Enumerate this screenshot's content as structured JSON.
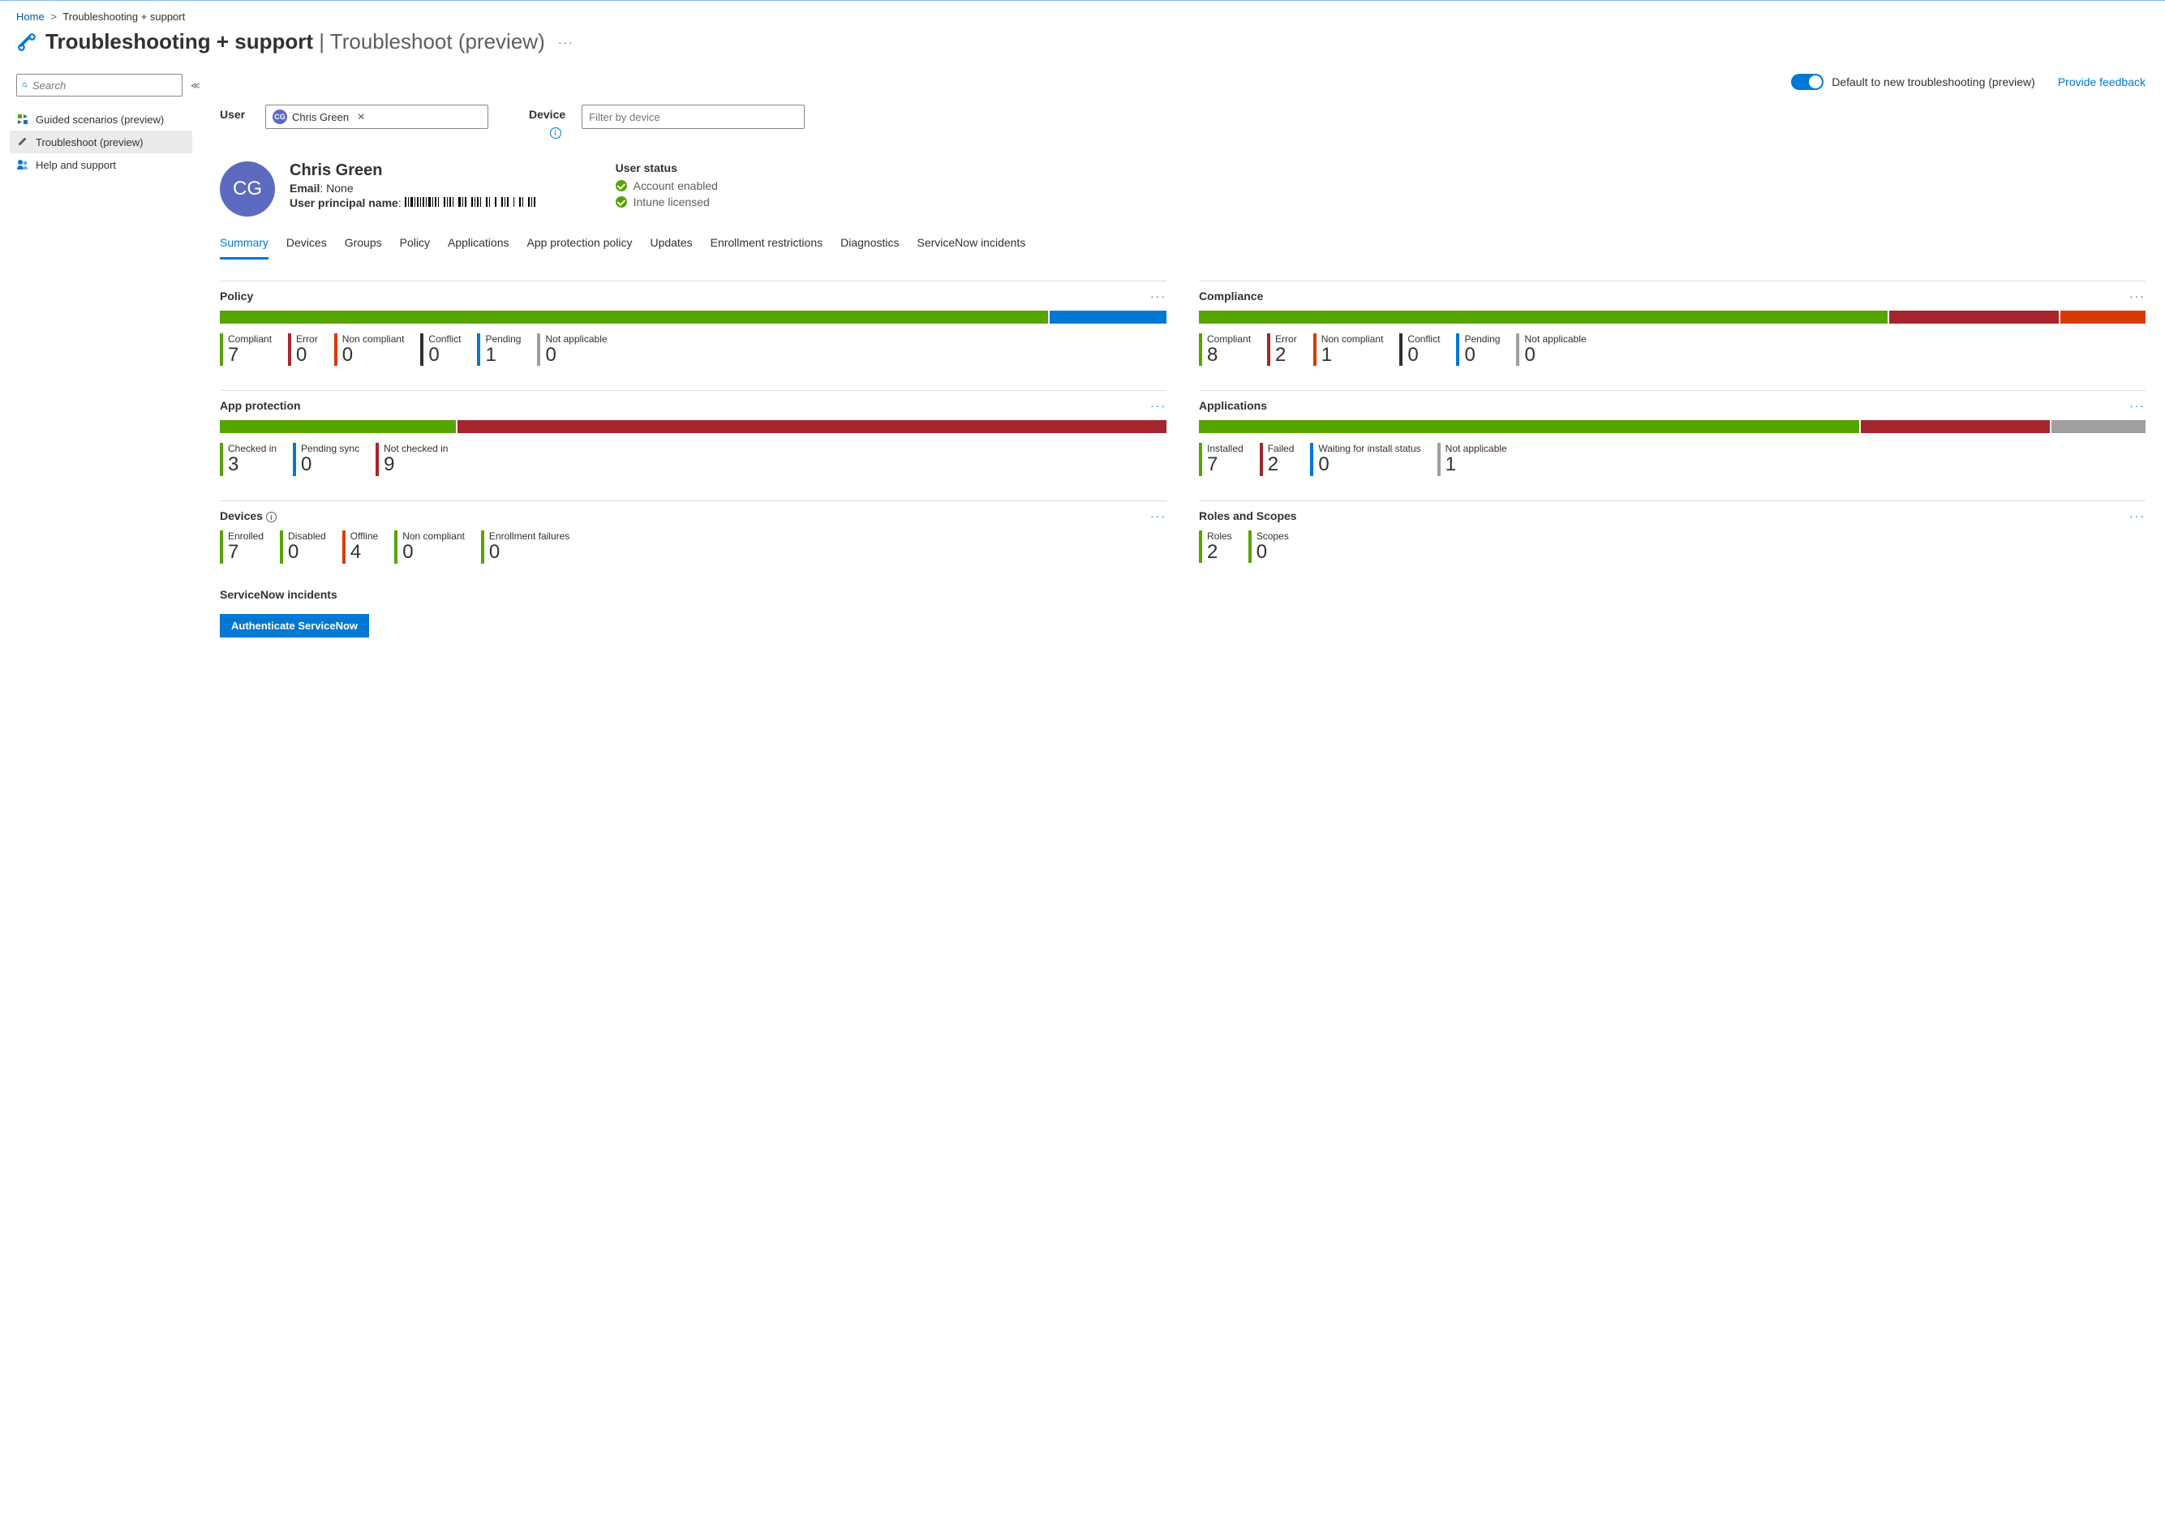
{
  "colors": {
    "green": "#57a300",
    "red": "#a4262c",
    "orange": "#d83b01",
    "blue": "#0078d4",
    "gray": "#a19f9d",
    "black": "#323130"
  },
  "breadcrumb": {
    "home": "Home",
    "section": "Troubleshooting + support"
  },
  "header": {
    "title": "Troubleshooting + support",
    "subtitle": "Troubleshoot (preview)"
  },
  "sidebar": {
    "search_placeholder": "Search",
    "items": [
      {
        "label": "Guided scenarios (preview)",
        "icon": "guided"
      },
      {
        "label": "Troubleshoot (preview)",
        "icon": "tool",
        "active": true
      },
      {
        "label": "Help and support",
        "icon": "help"
      }
    ]
  },
  "toolbar": {
    "toggle_label": "Default to new troubleshooting (preview)",
    "feedback": "Provide feedback"
  },
  "filters": {
    "user_label": "User",
    "user_chip": "Chris Green",
    "user_initials": "CG",
    "device_label": "Device",
    "device_placeholder": "Filter by device"
  },
  "user": {
    "initials": "CG",
    "name": "Chris Green",
    "email_label": "Email",
    "email_value": "None",
    "upn_label": "User principal name",
    "status_title": "User status",
    "status_account": "Account enabled",
    "status_license": "Intune licensed"
  },
  "tabs": [
    "Summary",
    "Devices",
    "Groups",
    "Policy",
    "Applications",
    "App protection policy",
    "Updates",
    "Enrollment restrictions",
    "Diagnostics",
    "ServiceNow incidents"
  ],
  "active_tab": 0,
  "cards": {
    "policy": {
      "title": "Policy",
      "bar": [
        {
          "color": "green",
          "flex": 85
        },
        {
          "color": "blue",
          "flex": 12
        }
      ],
      "stats": [
        {
          "label": "Compliant",
          "value": "7",
          "color": "green"
        },
        {
          "label": "Error",
          "value": "0",
          "color": "red"
        },
        {
          "label": "Non compliant",
          "value": "0",
          "color": "orange"
        },
        {
          "label": "Conflict",
          "value": "0",
          "color": "black"
        },
        {
          "label": "Pending",
          "value": "1",
          "color": "blue"
        },
        {
          "label": "Not applicable",
          "value": "0",
          "color": "gray"
        }
      ]
    },
    "compliance": {
      "title": "Compliance",
      "bar": [
        {
          "color": "green",
          "flex": 73
        },
        {
          "color": "red",
          "flex": 18
        },
        {
          "color": "orange",
          "flex": 9
        }
      ],
      "stats": [
        {
          "label": "Compliant",
          "value": "8",
          "color": "green"
        },
        {
          "label": "Error",
          "value": "2",
          "color": "red"
        },
        {
          "label": "Non compliant",
          "value": "1",
          "color": "orange"
        },
        {
          "label": "Conflict",
          "value": "0",
          "color": "black"
        },
        {
          "label": "Pending",
          "value": "0",
          "color": "blue"
        },
        {
          "label": "Not applicable",
          "value": "0",
          "color": "gray"
        }
      ]
    },
    "app_protection": {
      "title": "App protection",
      "bar": [
        {
          "color": "green",
          "flex": 25
        },
        {
          "color": "red",
          "flex": 75
        }
      ],
      "stats": [
        {
          "label": "Checked in",
          "value": "3",
          "color": "green"
        },
        {
          "label": "Pending sync",
          "value": "0",
          "color": "blue"
        },
        {
          "label": "Not checked in",
          "value": "9",
          "color": "red"
        }
      ]
    },
    "applications": {
      "title": "Applications",
      "bar": [
        {
          "color": "green",
          "flex": 70
        },
        {
          "color": "red",
          "flex": 20
        },
        {
          "color": "gray",
          "flex": 10
        }
      ],
      "stats": [
        {
          "label": "Installed",
          "value": "7",
          "color": "green"
        },
        {
          "label": "Failed",
          "value": "2",
          "color": "red"
        },
        {
          "label": "Waiting for install status",
          "value": "0",
          "color": "blue"
        },
        {
          "label": "Not applicable",
          "value": "1",
          "color": "gray"
        }
      ]
    },
    "devices": {
      "title": "Devices",
      "info": true,
      "stats": [
        {
          "label": "Enrolled",
          "value": "7",
          "color": "green"
        },
        {
          "label": "Disabled",
          "value": "0",
          "color": "green"
        },
        {
          "label": "Offline",
          "value": "4",
          "color": "orange"
        },
        {
          "label": "Non compliant",
          "value": "0",
          "color": "green"
        },
        {
          "label": "Enrollment failures",
          "value": "0",
          "color": "green"
        }
      ]
    },
    "roles": {
      "title": "Roles and Scopes",
      "stats": [
        {
          "label": "Roles",
          "value": "2",
          "color": "green"
        },
        {
          "label": "Scopes",
          "value": "0",
          "color": "green"
        }
      ]
    }
  },
  "servicenow": {
    "title": "ServiceNow incidents",
    "button": "Authenticate ServiceNow"
  }
}
